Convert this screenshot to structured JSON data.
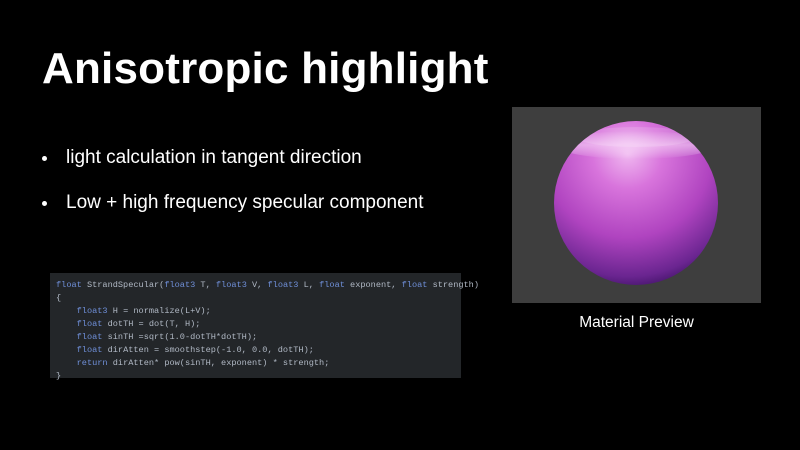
{
  "slide": {
    "title": "Anisotropic highlight",
    "bullets": [
      "light calculation in tangent direction",
      "Low + high frequency specular component"
    ]
  },
  "code": {
    "lines": [
      [
        {
          "t": "float",
          "k": true
        },
        {
          "t": " StrandSpecular("
        },
        {
          "t": "float3",
          "k": true
        },
        {
          "t": " T, "
        },
        {
          "t": "float3",
          "k": true
        },
        {
          "t": " V, "
        },
        {
          "t": "float3",
          "k": true
        },
        {
          "t": " L, "
        },
        {
          "t": "float",
          "k": true
        },
        {
          "t": " exponent, "
        },
        {
          "t": "float",
          "k": true
        },
        {
          "t": " strength)"
        }
      ],
      [
        {
          "t": "{"
        }
      ],
      [
        {
          "t": "    "
        },
        {
          "t": "float3",
          "k": true
        },
        {
          "t": " H = normalize(L+V);"
        }
      ],
      [
        {
          "t": "    "
        },
        {
          "t": "float",
          "k": true
        },
        {
          "t": " dotTH = dot(T, H);"
        }
      ],
      [
        {
          "t": "    "
        },
        {
          "t": "float",
          "k": true
        },
        {
          "t": " sinTH =sqrt(1.0-dotTH*dotTH);"
        }
      ],
      [
        {
          "t": "    "
        },
        {
          "t": "float",
          "k": true
        },
        {
          "t": " dirAtten = smoothstep(-1.0, 0.0, dotTH);"
        }
      ],
      [
        {
          "t": "    "
        },
        {
          "t": "return",
          "k": true
        },
        {
          "t": " dirAtten* pow(sinTH, exponent) * strength;"
        }
      ],
      [
        {
          "t": "}"
        }
      ]
    ]
  },
  "preview": {
    "caption": "Material Preview"
  },
  "colors": {
    "background": "#000000",
    "text": "#ffffff",
    "code_bg": "#232629",
    "code_keyword": "#6f8fd8",
    "code_text": "#b0b8c4",
    "preview_bg": "#3e3e3e",
    "sphere_highlight": "#f0b8f0",
    "sphere_base": "#b044c0",
    "sphere_shadow": "#3a1060"
  }
}
